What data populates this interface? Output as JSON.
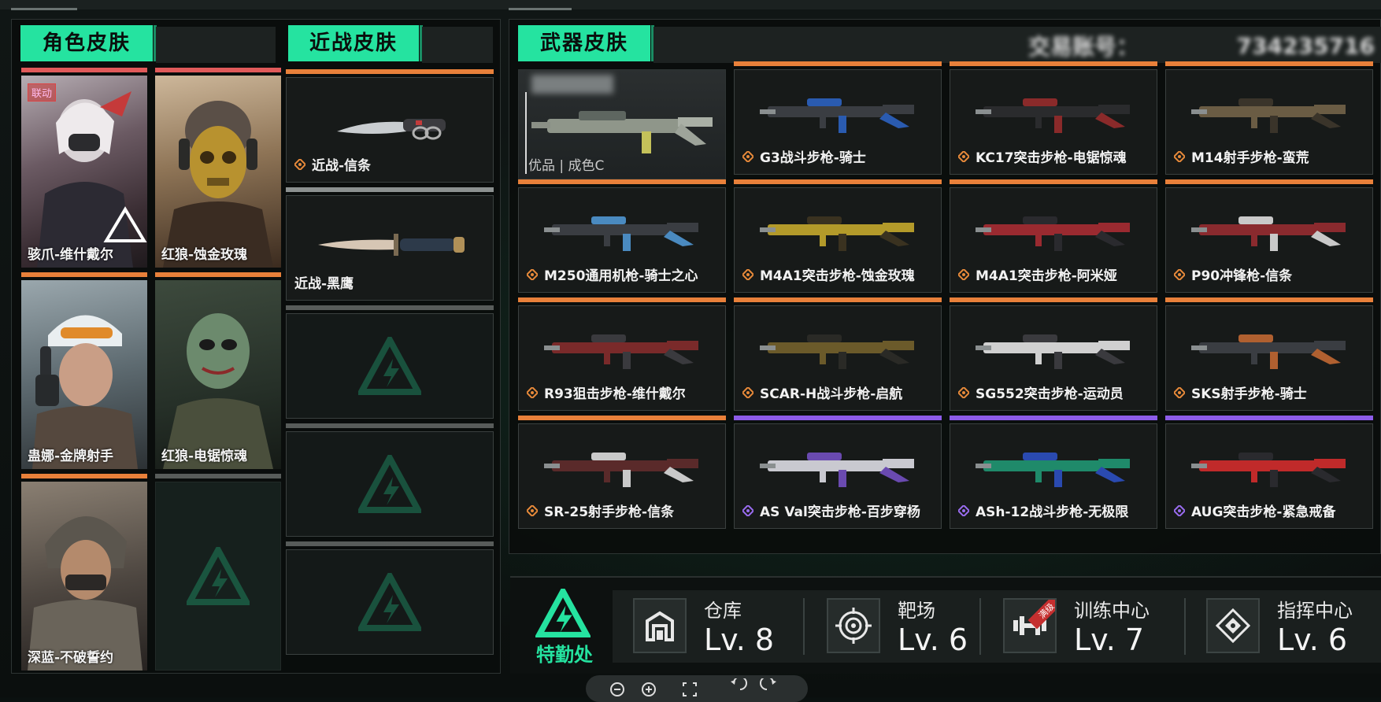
{
  "sections": {
    "character_title": "角色皮肤",
    "melee_title": "近战皮肤",
    "weapon_title": "武器皮肤",
    "blurred_id_label": "交易账号：",
    "blurred_id_value": "734235716"
  },
  "colors": {
    "accent": "#25e3a0",
    "stripe_orange": "#e8803a",
    "stripe_red": "#e05a5a",
    "stripe_gray": "#8c9190",
    "stripe_purple": "#8c5ce8",
    "rarity_orange": "#e88a3a",
    "rarity_purple": "#9a6cf0"
  },
  "characters": [
    {
      "name": "骇爪-维什戴尔",
      "tag": "联动",
      "stripe": "red"
    },
    {
      "name": "红狼-蚀金玫瑰",
      "stripe": "red"
    },
    {
      "name": "蛊娜-金牌射手",
      "stripe": "orange"
    },
    {
      "name": "红狼-电锯惊魂",
      "stripe": "orange"
    },
    {
      "name": "深蓝-不破誓约",
      "stripe": "orange"
    },
    {
      "name": "",
      "stripe": "gray"
    }
  ],
  "melee": [
    {
      "name": "近战-信条",
      "rarity": "orange",
      "stripe": "orange"
    },
    {
      "name": "近战-黑鹰",
      "rarity": "none",
      "stripe": "gray"
    },
    {
      "name": "",
      "stripe": "gray"
    },
    {
      "name": "",
      "stripe": "gray"
    },
    {
      "name": "",
      "stripe": "gray"
    }
  ],
  "featured_weapon": {
    "quality_text": "优品 | 成色C"
  },
  "weapons": [
    {
      "name": "G3战斗步枪-骑士",
      "rarity": "orange"
    },
    {
      "name": "KC17突击步枪-电锯惊魂",
      "rarity": "orange"
    },
    {
      "name": "M14射手步枪-蛮荒",
      "rarity": "orange"
    },
    {
      "name": "M250通用机枪-骑士之心",
      "rarity": "orange"
    },
    {
      "name": "M4A1突击步枪-蚀金玫瑰",
      "rarity": "orange"
    },
    {
      "name": "M4A1突击步枪-阿米娅",
      "rarity": "orange"
    },
    {
      "name": "P90冲锋枪-信条",
      "rarity": "orange"
    },
    {
      "name": "R93狙击步枪-维什戴尔",
      "rarity": "orange"
    },
    {
      "name": "SCAR-H战斗步枪-启航",
      "rarity": "orange"
    },
    {
      "name": "SG552突击步枪-运动员",
      "rarity": "orange"
    },
    {
      "name": "SKS射手步枪-骑士",
      "rarity": "orange"
    },
    {
      "name": "SR-25射手步枪-信条",
      "rarity": "orange"
    },
    {
      "name": "AS Val突击步枪-百步穿杨",
      "rarity": "purple"
    },
    {
      "name": "ASh-12战斗步枪-无极限",
      "rarity": "purple"
    },
    {
      "name": "AUG突击步枪-紧急戒备",
      "rarity": "purple"
    }
  ],
  "hq": {
    "label": "特勤处"
  },
  "facilities": [
    {
      "name": "仓库",
      "level": "Lv. 8",
      "icon": "warehouse-icon"
    },
    {
      "name": "靶场",
      "level": "Lv. 6",
      "icon": "target-icon"
    },
    {
      "name": "训练中心",
      "level": "Lv. 7",
      "icon": "dumbbell-icon",
      "badge": "满级"
    },
    {
      "name": "指挥中心",
      "level": "Lv. 6",
      "icon": "command-icon"
    }
  ],
  "zoom_controls": [
    "zoom-out",
    "zoom-in",
    "fit",
    "rotate-left",
    "rotate-right"
  ]
}
